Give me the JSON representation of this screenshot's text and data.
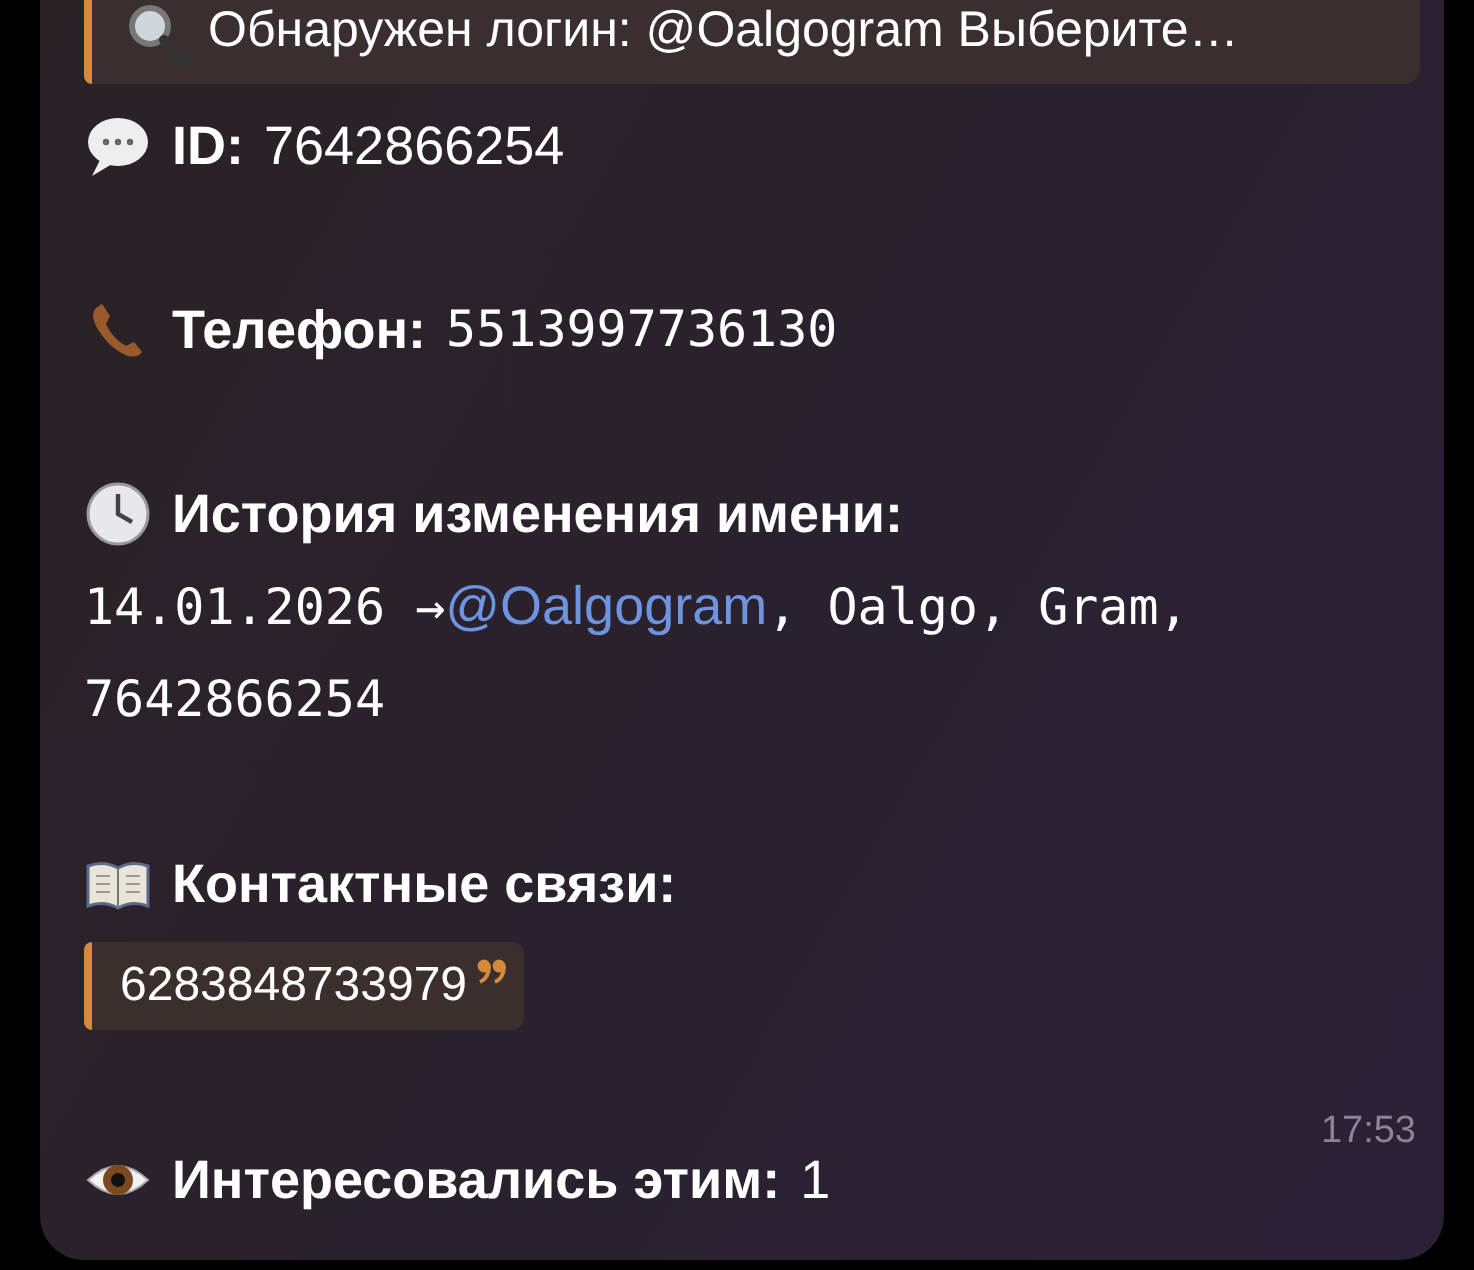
{
  "reply_quote": {
    "text": "Обнаружен логин: @Oalgogram Выберите…"
  },
  "sections": [
    {
      "kind": "field",
      "label": "ID:",
      "value": "7642866254"
    },
    {
      "kind": "field-mono",
      "label": "Телефон:",
      "value": "5513997736130"
    },
    {
      "kind": "history",
      "label": "История изменения имени:",
      "parts": [
        {
          "kind": "mono",
          "text": "14.01.2026 →"
        },
        {
          "kind": "link",
          "text": "@Oalgogram"
        },
        {
          "kind": "mono",
          "text": ", Oalgo, Gram,"
        },
        {
          "kind": "mono-line",
          "text": "7642866254"
        }
      ]
    },
    {
      "kind": "quote",
      "label": "Контактные связи:",
      "quote": "6283848733979"
    },
    {
      "kind": "field",
      "label": "Интересовались этим:",
      "value": "1"
    }
  ],
  "time": "17:53"
}
